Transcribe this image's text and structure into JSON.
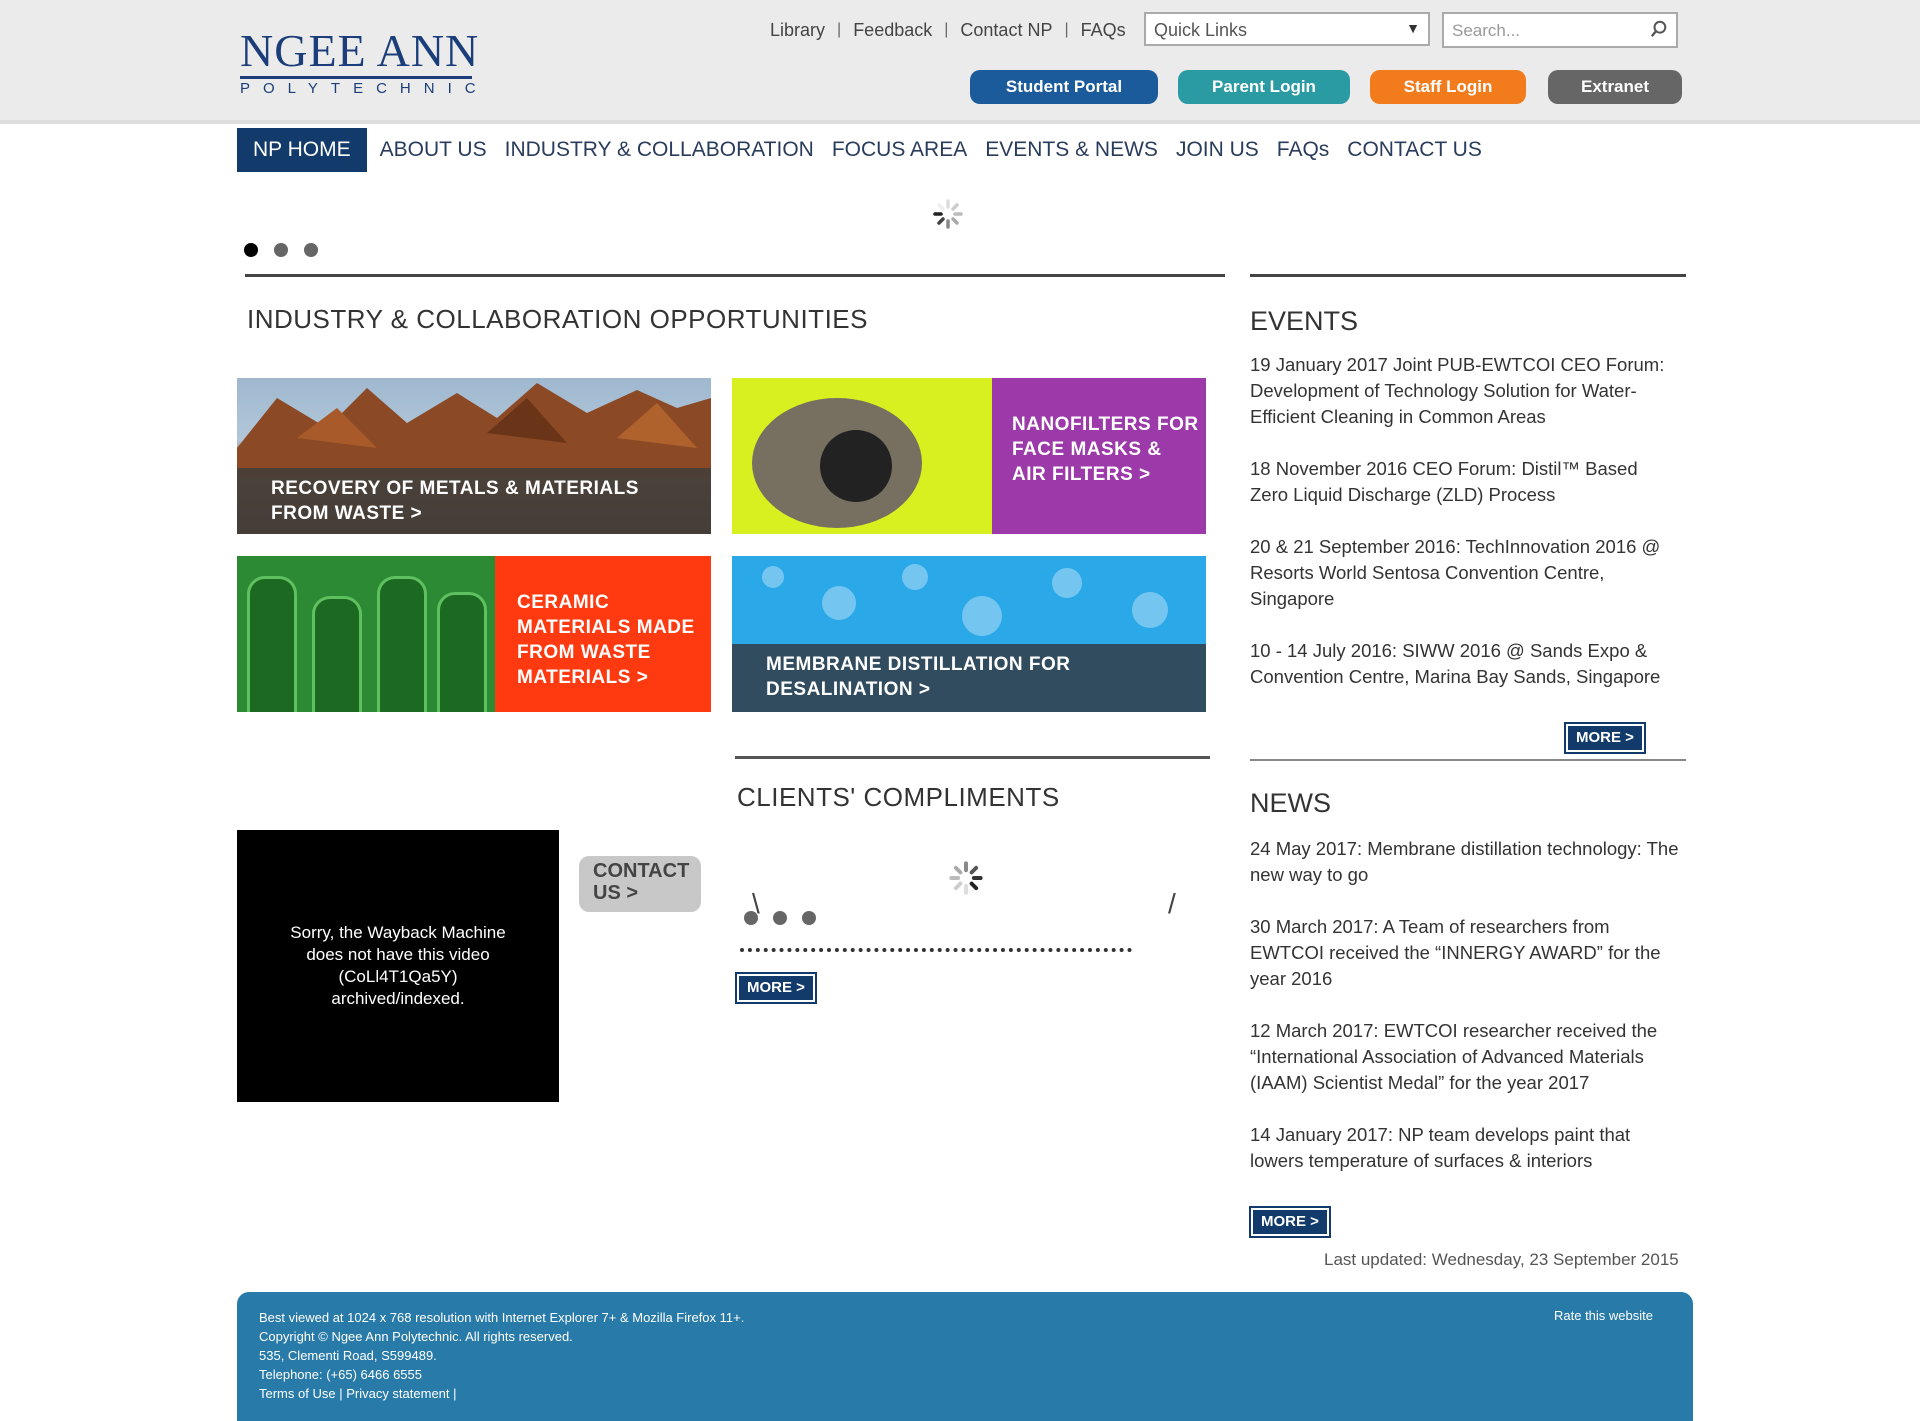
{
  "header": {
    "logo": {
      "line1": "NGEE ANN",
      "line2": "POLYTECHNIC"
    },
    "top_links": [
      "Library",
      "Feedback",
      "Contact NP",
      "FAQs"
    ],
    "quick_links": {
      "selected": "Quick Links"
    },
    "search": {
      "placeholder": "Search..."
    },
    "login_buttons": {
      "student": "Student Portal",
      "parent": "Parent Login",
      "staff": "Staff Login",
      "extranet": "Extranet"
    }
  },
  "nav": {
    "items": [
      "NP HOME",
      "ABOUT US",
      "INDUSTRY & COLLABORATION",
      "FOCUS AREA",
      "EVENTS & NEWS",
      "JOIN US",
      "FAQs",
      "CONTACT US"
    ]
  },
  "industry": {
    "title": "INDUSTRY & COLLABORATION OPPORTUNITIES",
    "tiles": {
      "metals": [
        "RECOVERY OF METALS & MATERIALS",
        "FROM WASTE >"
      ],
      "nano": [
        "NANOFILTERS FOR",
        "FACE MASKS &",
        "AIR FILTERS >"
      ],
      "ceramic": [
        "CERAMIC",
        "MATERIALS MADE",
        "FROM WASTE",
        "MATERIALS >"
      ],
      "membrane": [
        "MEMBRANE DISTILLATION FOR",
        "DESALINATION >"
      ]
    }
  },
  "video": {
    "message": "Sorry, the Wayback Machine does not have this video (CoLl4T1Qa5Y) archived/indexed."
  },
  "contact_button": {
    "line1": "CONTACT",
    "line2": "US >"
  },
  "compliments": {
    "title": "CLIENTS' COMPLIMENTS",
    "more": "MORE >"
  },
  "events": {
    "title": "EVENTS",
    "items": [
      "19 January 2017 Joint PUB-EWTCOI CEO Forum: Development of Technology Solution for Water-Efficient Cleaning in Common Areas",
      "18 November 2016 CEO Forum: Distil™ Based Zero Liquid Discharge (ZLD) Process",
      "20 & 21 September 2016: TechInnovation 2016 @ Resorts World Sentosa Convention Centre, Singapore",
      "10 - 14 July 2016: SIWW 2016 @ Sands Expo & Convention Centre, Marina Bay Sands, Singapore"
    ],
    "more": "MORE >"
  },
  "news": {
    "title": "NEWS",
    "items": [
      "24 May 2017: Membrane distillation technology: The new way to go",
      "30 March 2017: A Team of researchers from EWTCOI received the “INNERGY AWARD” for the year 2016",
      "12 March 2017: EWTCOI researcher received the “International Association of Advanced Materials (IAAM) Scientist Medal” for the year 2017",
      "14 January 2017: NP team develops paint that lowers temperature of surfaces & interiors"
    ],
    "more": "MORE >"
  },
  "last_updated": "Last updated: Wednesday, 23 September 2015",
  "footer": {
    "lines": [
      "Best viewed at 1024 x 768 resolution with Internet Explorer 7+ & Mozilla Firefox 11+.",
      "Copyright © Ngee Ann Polytechnic. All rights reserved.",
      "535, Clementi Road, S599489.",
      "Telephone: (+65) 6466 6555"
    ],
    "terms": "Terms of Use",
    "privacy": "Privacy statement",
    "rate": "Rate this website"
  },
  "colors": {
    "brand_navy": "#123a6a",
    "student": "#1b5b9c",
    "parent": "#2a9aa3",
    "staff": "#f27b1c",
    "extranet": "#666666",
    "footer": "#287aa8"
  }
}
